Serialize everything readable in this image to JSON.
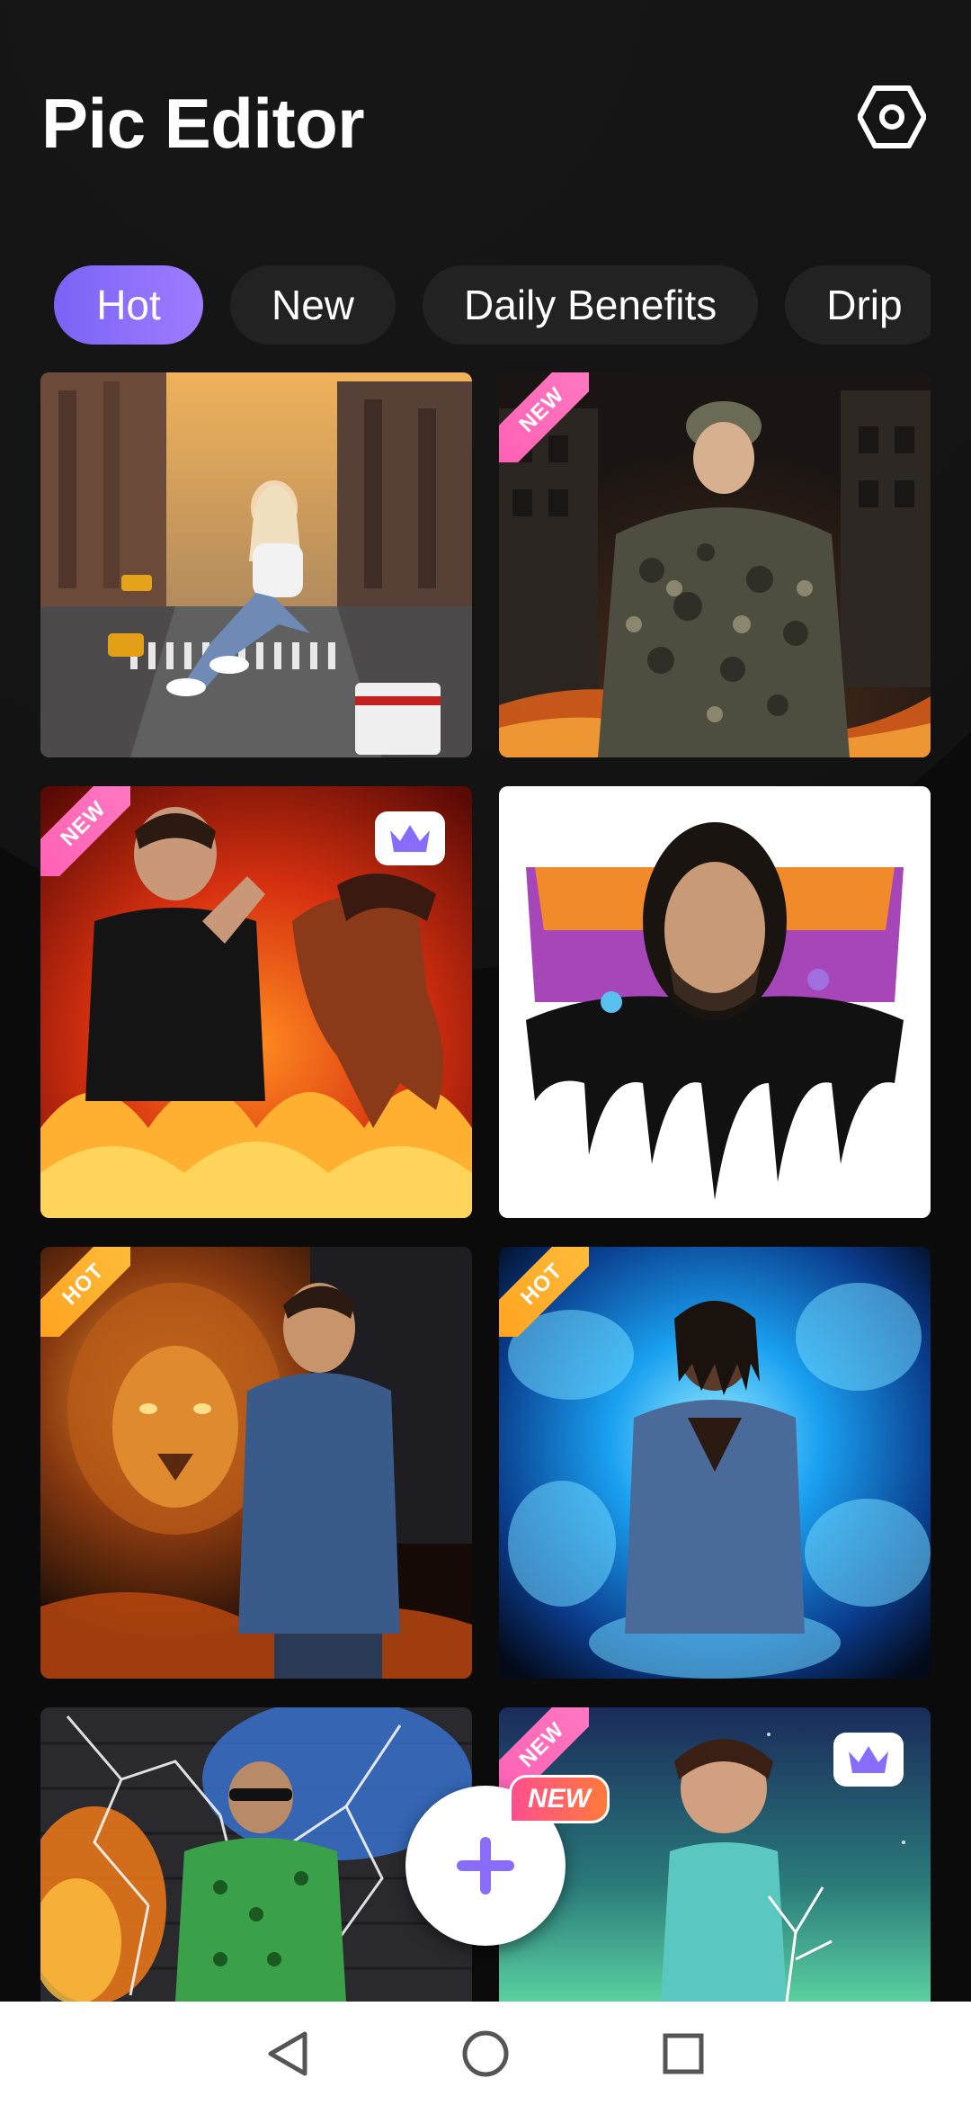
{
  "app": {
    "title": "Pic Editor",
    "accent": "#8a6cfb"
  },
  "tabs": [
    {
      "label": "Hot",
      "active": true
    },
    {
      "label": "New",
      "active": false
    },
    {
      "label": "Daily Benefits",
      "active": false
    },
    {
      "label": "Drip",
      "active": false
    }
  ],
  "templates": [
    {
      "name": "city-giant-girl",
      "badge": "",
      "premium": false
    },
    {
      "name": "soldier-fire-city",
      "badge": "NEW",
      "premium": false
    },
    {
      "name": "man-fire-horse",
      "badge": "NEW",
      "premium": true
    },
    {
      "name": "drip-portrait",
      "badge": "",
      "premium": false
    },
    {
      "name": "fire-lion-man",
      "badge": "HOT",
      "premium": false
    },
    {
      "name": "blue-smoke-man",
      "badge": "HOT",
      "premium": false
    },
    {
      "name": "shattered-glass-man",
      "badge": "",
      "premium": false
    },
    {
      "name": "aurora-girl",
      "badge": "NEW",
      "premium": true
    }
  ],
  "fab": {
    "badge": "NEW",
    "icon": "plus-icon"
  },
  "navbar": {
    "icons": [
      "back-icon",
      "home-icon",
      "recents-icon"
    ]
  }
}
